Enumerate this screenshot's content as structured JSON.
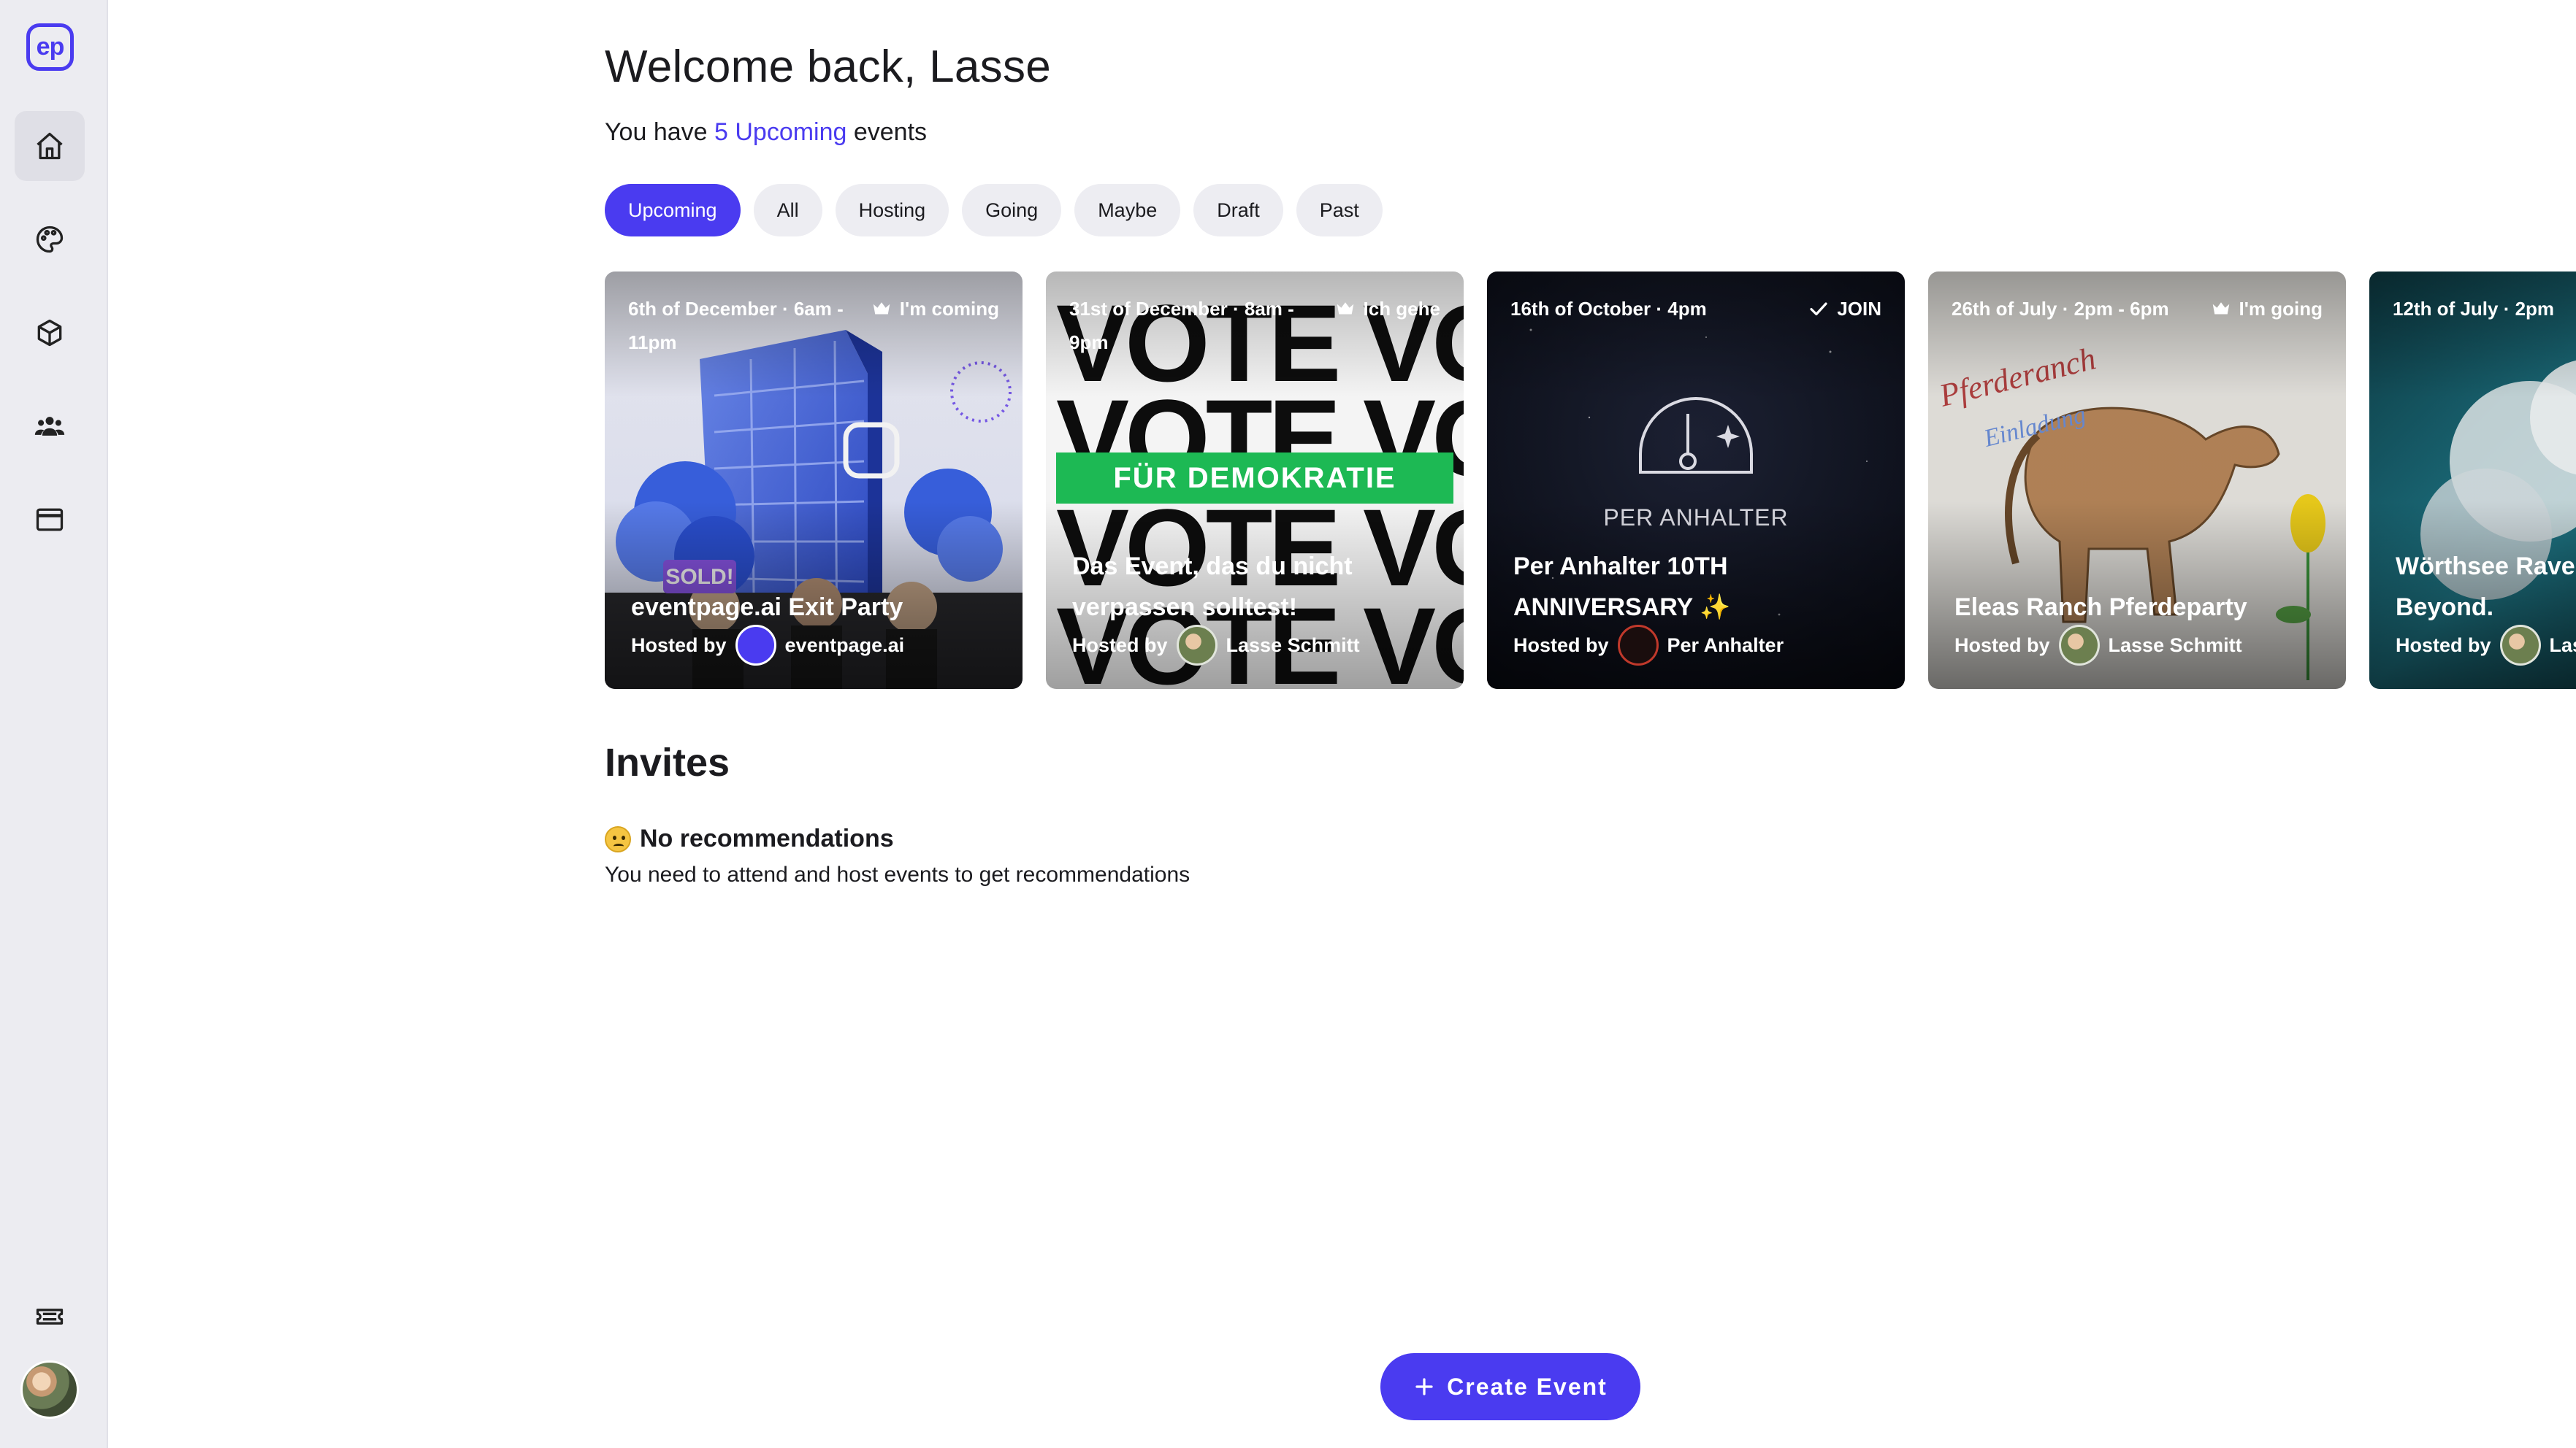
{
  "sidebar": {
    "logo_text": "ep",
    "nav": [
      "home-icon",
      "palette-icon",
      "cube-icon",
      "people-icon",
      "browser-window-icon"
    ],
    "bottom": [
      "ticket-icon",
      "avatar"
    ]
  },
  "header": {
    "greeting": "Welcome back, Lasse",
    "subline_prefix": "You have ",
    "subline_count": "5 Upcoming",
    "subline_suffix": " events"
  },
  "tabs": [
    "Upcoming",
    "All",
    "Hosting",
    "Going",
    "Maybe",
    "Draft",
    "Past"
  ],
  "active_tab": "Upcoming",
  "events": [
    {
      "date": "6th of December · 6am - 11pm",
      "status": "I'm coming",
      "status_icon": "crown-icon",
      "title": "eventpage.ai Exit Party",
      "hosted_by_label": "Hosted by",
      "host": "eventpage.ai"
    },
    {
      "date": "31st of December · 8am - 9pm",
      "status": "Ich gehe",
      "status_icon": "crown-icon",
      "banner": "FÜR DEMOKRATIE",
      "title": "Das Event, das du nicht verpassen solltest!",
      "hosted_by_label": "Hosted by",
      "host": "Lasse Schmitt"
    },
    {
      "date": "16th of October · 4pm",
      "status": "JOIN",
      "status_icon": "check-icon",
      "logo_text": "PER ANHALTER",
      "title": "Per Anhalter 10TH ANNIVERSARY ✨",
      "hosted_by_label": "Hosted by",
      "host": "Per Anhalter"
    },
    {
      "date": "26th of July · 2pm - 6pm",
      "status": "I'm going",
      "status_icon": "crown-icon",
      "title": "Eleas Ranch Pferdeparty",
      "hosted_by_label": "Hosted by",
      "host": "Lasse Schmitt"
    },
    {
      "date": "12th of July · 2pm",
      "status": "",
      "title": "Wörthsee Rave Bass & Beyond.",
      "hosted_by_label": "Hosted by",
      "host": "Lasse Schmitt"
    }
  ],
  "invites": {
    "title": "Invites",
    "empty_title": "No recommendations",
    "empty_text": "You need to attend and host events to get recommendations"
  },
  "create_button": "Create Event",
  "colors": {
    "accent": "#4a3bf0",
    "sidebar_bg": "#ececf1",
    "tab_bg": "#ededf2",
    "banner_green": "#1db954"
  }
}
